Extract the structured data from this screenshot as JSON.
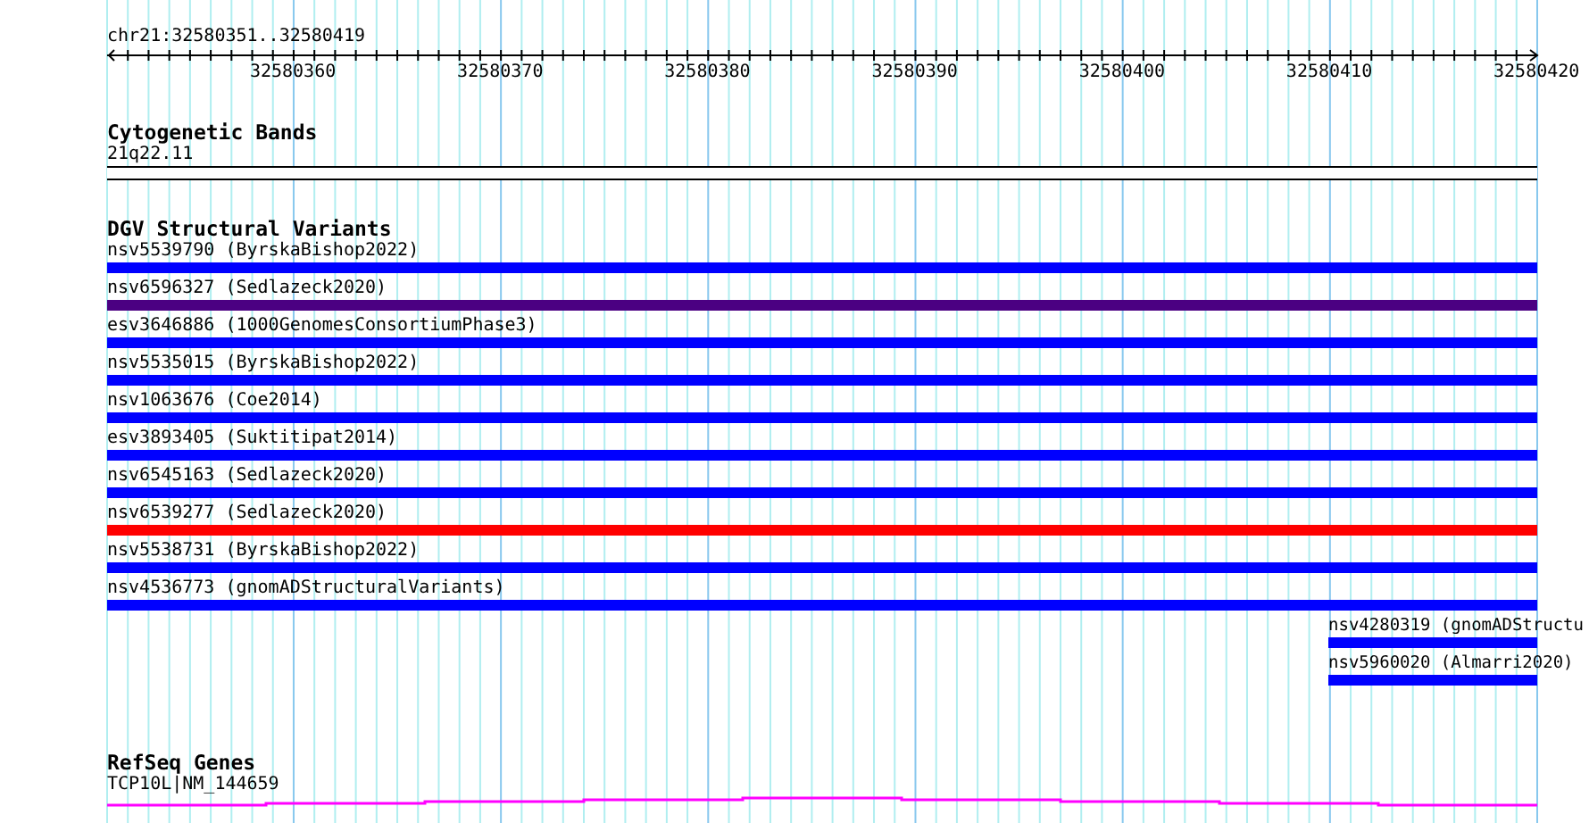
{
  "position_label": "chr21:32580351..32580419",
  "ruler": {
    "tick_labels": [
      "32580360",
      "32580370",
      "32580380",
      "32580390",
      "32580400",
      "32580410",
      "32580420"
    ]
  },
  "cytogenetic_bands": {
    "title": "Cytogenetic Bands",
    "label": "21q22.11"
  },
  "dgv_variants": {
    "title": "DGV Structural Variants",
    "items": [
      {
        "label": "nsv5539790 (ByrskaBishop2022)",
        "color": "#0000ff",
        "kind": "full"
      },
      {
        "label": "nsv6596327 (Sedlazeck2020)",
        "color": "#4b0082",
        "kind": "full"
      },
      {
        "label": "esv3646886 (1000GenomesConsortiumPhase3)",
        "color": "#0000ff",
        "kind": "full"
      },
      {
        "label": "nsv5535015 (ByrskaBishop2022)",
        "color": "#0000ff",
        "kind": "full"
      },
      {
        "label": "nsv1063676 (Coe2014)",
        "color": "#0000ff",
        "kind": "full"
      },
      {
        "label": "esv3893405 (Suktitipat2014)",
        "color": "#0000ff",
        "kind": "full"
      },
      {
        "label": "nsv6545163 (Sedlazeck2020)",
        "color": "#0000ff",
        "kind": "full"
      },
      {
        "label": "nsv6539277 (Sedlazeck2020)",
        "color": "#ff0000",
        "kind": "full"
      },
      {
        "label": "nsv5538731 (ByrskaBishop2022)",
        "color": "#0000ff",
        "kind": "full"
      },
      {
        "label": "nsv4536773 (gnomADStructuralVariants)",
        "color": "#0000ff",
        "kind": "full"
      },
      {
        "label": "nsv4280319 (gnomADStructu",
        "color": "#0000ff",
        "kind": "right"
      },
      {
        "label": "nsv5960020 (Almarri2020)",
        "color": "#0000ff",
        "kind": "right"
      }
    ]
  },
  "refseq_genes": {
    "title": "RefSeq Genes",
    "label": "TCP10L|NM_144659"
  }
}
